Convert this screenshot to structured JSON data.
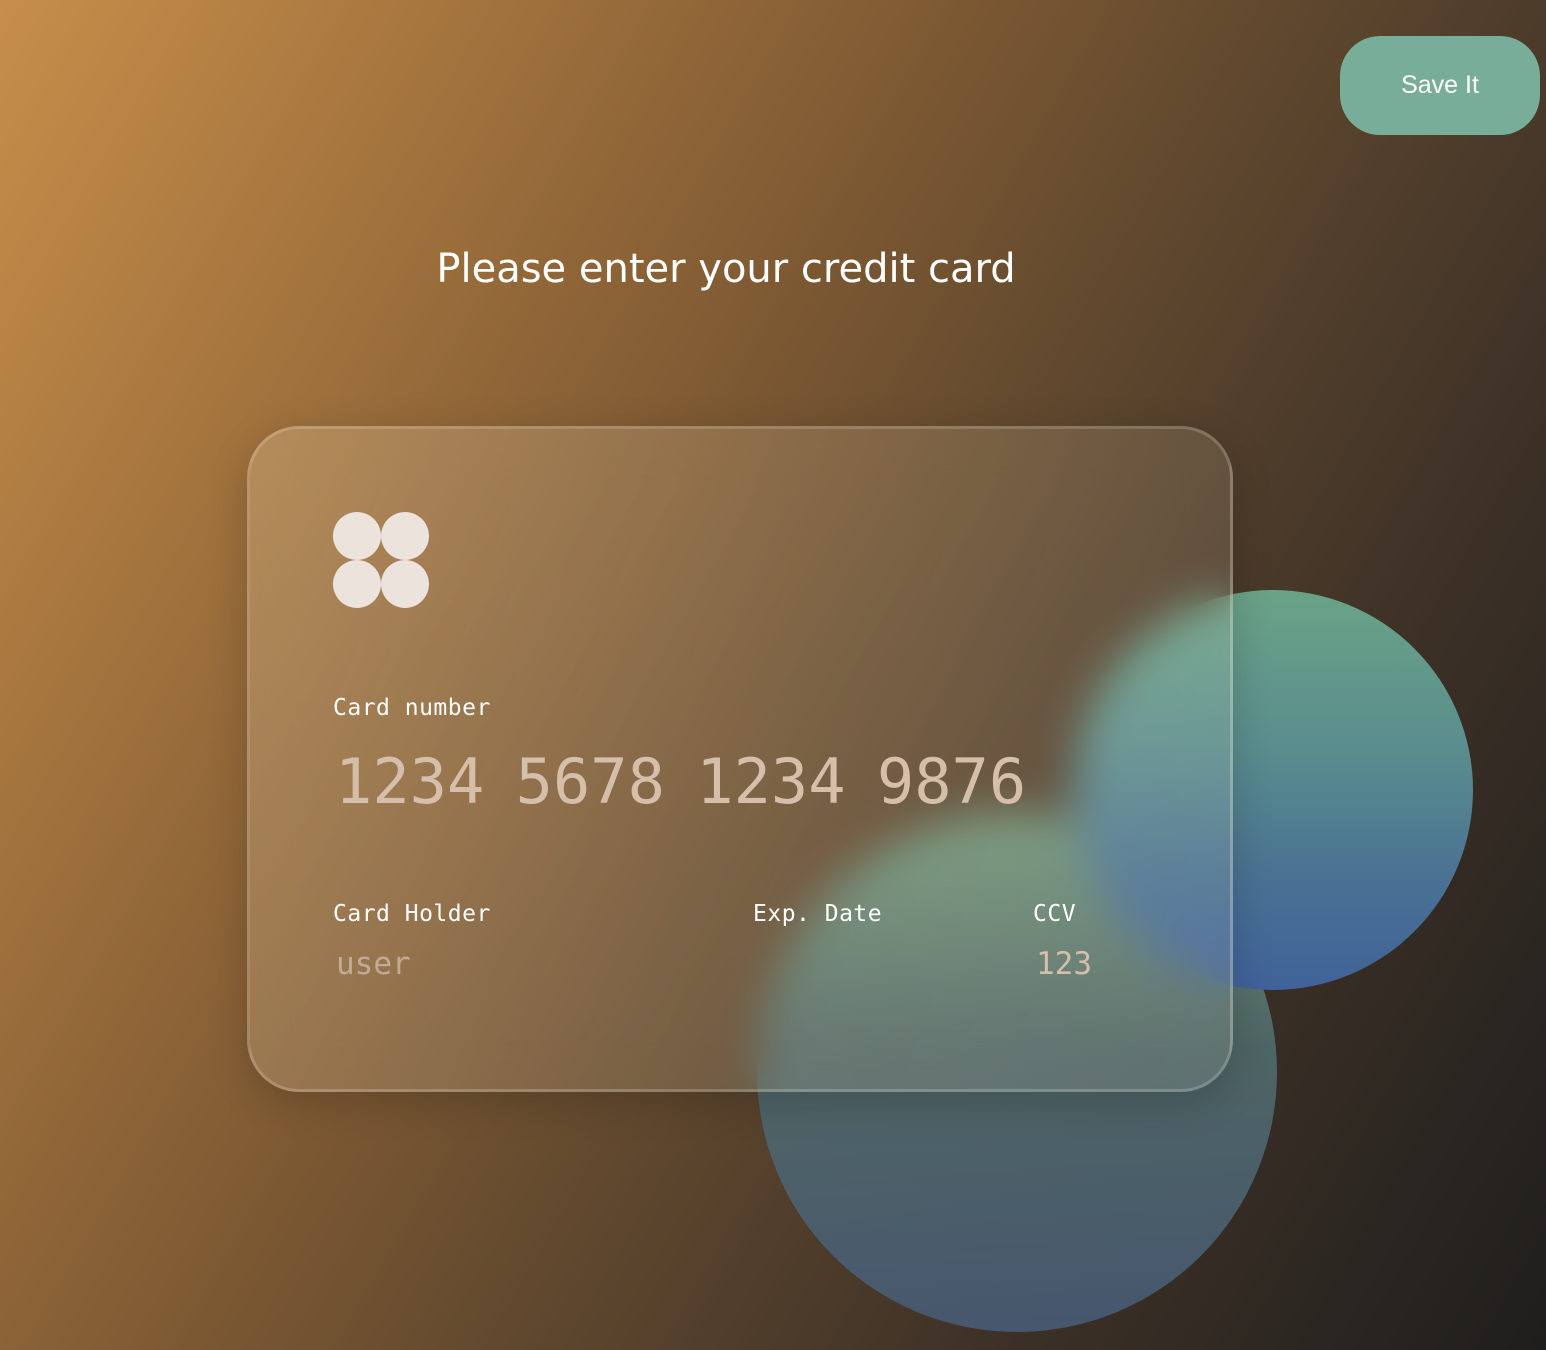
{
  "toolbar": {
    "save_label": "Save It"
  },
  "page": {
    "title": "Please enter your credit card"
  },
  "card": {
    "logo_icon": "four-circles-logo",
    "number": {
      "label": "Card number",
      "placeholder": "1234 5678 1234 9876",
      "value": ""
    },
    "holder": {
      "label": "Card Holder",
      "placeholder": "user",
      "value": ""
    },
    "exp_date": {
      "label": "Exp. Date",
      "placeholder": "",
      "value": ""
    },
    "ccv": {
      "label": "CCV",
      "placeholder": "123",
      "value": ""
    }
  },
  "colors": {
    "save_button": "#78ae99",
    "logo": "#ece3dc",
    "placeholder_text": "#d5bfab"
  }
}
